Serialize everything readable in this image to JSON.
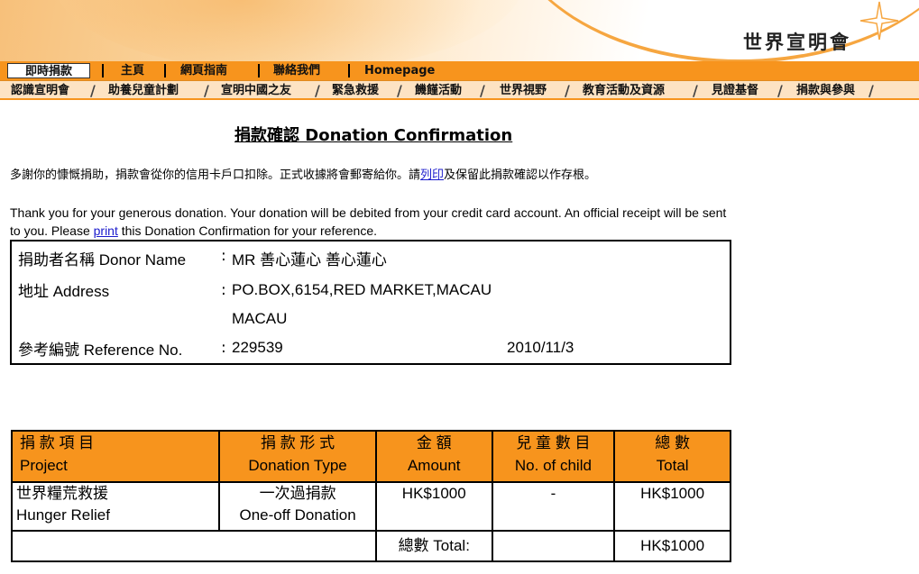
{
  "header": {
    "logo": "世界宣明會",
    "topnav": [
      "即時捐款",
      "主頁",
      "網頁指南",
      "聯絡我們",
      "Homepage"
    ],
    "secnav": [
      "認識宣明會",
      "助養兒童計劃",
      "宣明中國之友",
      "緊急救援",
      "饑饉活動",
      "世界視野",
      "教育活動及資源",
      "見證基督",
      "捐款與參與"
    ]
  },
  "page": {
    "title": "捐款確認 Donation Confirmation",
    "message_zh_pre": "多謝你的慷慨捐助，捐款會從你的信用卡戶口扣除。正式收據將會郵寄給你。請",
    "message_zh_link": "列印",
    "message_zh_post": "及保留此捐款確認以作存根。",
    "message_en_pre": "Thank you for your generous donation. Your donation will be debited from your credit card account. An official receipt will be sent to you. Please ",
    "message_en_link": "print",
    "message_en_post": " this Donation Confirmation for your reference."
  },
  "donor": {
    "name_label": "捐助者名稱 Donor Name",
    "name_value": "MR 善心蓮心 善心蓮心",
    "address_label": "地址 Address",
    "address_line1": "PO.BOX,6154,RED MARKET,MACAU",
    "address_line2": "MACAU",
    "ref_label": "參考編號 Reference No.",
    "ref_value": "229539",
    "date": "2010/11/3",
    "colon": ":"
  },
  "table": {
    "headers": [
      {
        "zh": "捐 款 項 目",
        "en": "Project"
      },
      {
        "zh": "捐 款 形 式",
        "en": "Donation Type"
      },
      {
        "zh": "金 額",
        "en": "Amount"
      },
      {
        "zh": "兒 童 數 目",
        "en": "No. of child"
      },
      {
        "zh": "總 數",
        "en": "Total"
      }
    ],
    "row": {
      "project_zh": "世界糧荒救援",
      "project_en": "Hunger Relief",
      "type_zh": "一次過捐款",
      "type_en": "One-off Donation",
      "amount": "HK$1000",
      "children": "-",
      "total": "HK$1000"
    },
    "total_label": "總數 Total:",
    "grand_total": "HK$1000"
  },
  "colors": {
    "orange": "#f7941d",
    "light_orange": "#fde3c3",
    "link": "#1a1acc"
  }
}
